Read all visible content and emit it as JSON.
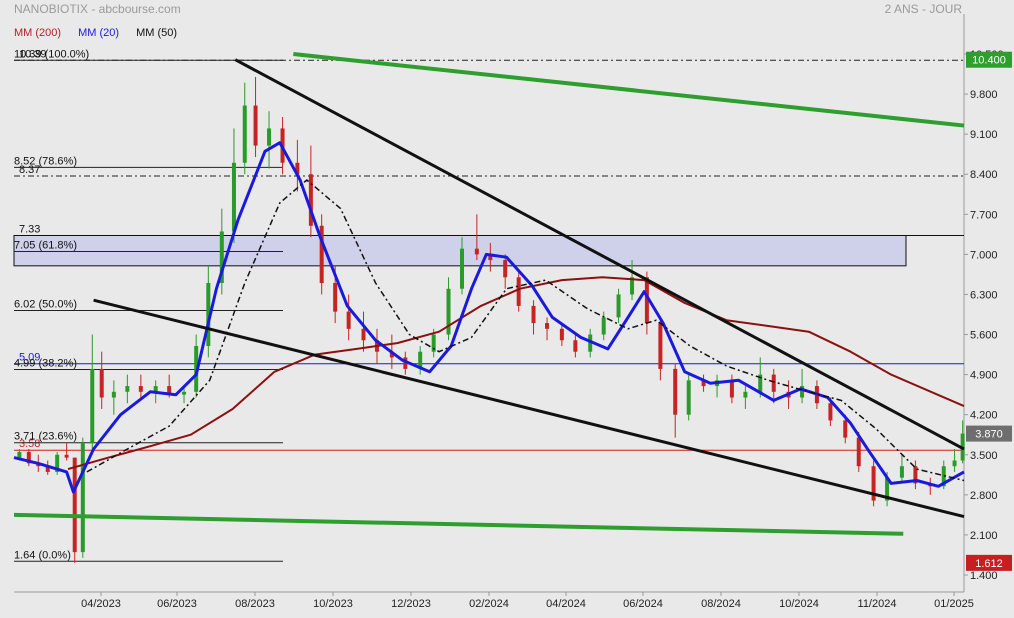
{
  "header": {
    "title": "NANOBIOTIX - abcbourse.com",
    "period": "2 ANS - JOUR"
  },
  "legend": [
    {
      "label": "MM (200)",
      "color": "#b22222"
    },
    {
      "label": "MM (20)",
      "color": "#1a1adb"
    },
    {
      "label": "MM (50)",
      "color": "#111111"
    }
  ],
  "chart_data": {
    "type": "line",
    "title": "NANOBIOTIX",
    "ylim": [
      1.4,
      10.5
    ],
    "y_ticks": [
      {
        "label": "10.500",
        "v": 10.5
      },
      {
        "label": "9.800",
        "v": 9.8
      },
      {
        "label": "9.100",
        "v": 9.1
      },
      {
        "label": "8.400",
        "v": 8.4
      },
      {
        "label": "7.700",
        "v": 7.7
      },
      {
        "label": "7.000",
        "v": 7.0
      },
      {
        "label": "6.300",
        "v": 6.3
      },
      {
        "label": "5.600",
        "v": 5.6
      },
      {
        "label": "4.900",
        "v": 4.9
      },
      {
        "label": "4.200",
        "v": 4.2
      },
      {
        "label": "3.500",
        "v": 3.5
      },
      {
        "label": "2.800",
        "v": 2.8
      },
      {
        "label": "2.100",
        "v": 2.1
      },
      {
        "label": "1.400",
        "v": 1.4
      }
    ],
    "x_labels": [
      "04/2023",
      "06/2023",
      "08/2023",
      "10/2023",
      "12/2023",
      "02/2024",
      "04/2024",
      "06/2024",
      "08/2024",
      "10/2024",
      "11/2024",
      "01/2025"
    ],
    "x_range": [
      "2023-02-20",
      "2025-01-24"
    ],
    "price_badges": [
      {
        "label": "10.400",
        "v": 10.4,
        "color": "#2e9e2e"
      },
      {
        "label": "3.870",
        "v": 3.87,
        "color": "#6e6e6e"
      },
      {
        "label": "1.612",
        "v": 1.612,
        "color": "#c61f1f"
      }
    ],
    "fibonacci": [
      {
        "label": "10.39 (100.0%)",
        "v": 10.39
      },
      {
        "label": "8.52  (78.6%)",
        "v": 8.52
      },
      {
        "label": "7.05  (61.8%)",
        "v": 7.05
      },
      {
        "label": "6.02  (50.0%)",
        "v": 6.02
      },
      {
        "label": "4.99  (38.2%)",
        "v": 4.99
      },
      {
        "label": "3.71  (23.6%)",
        "v": 3.71
      },
      {
        "label": "1.64  (0.0%)",
        "v": 1.64
      }
    ],
    "levels": [
      {
        "label": "10.39",
        "v": 10.39,
        "style": "dashdot",
        "color": "#222222"
      },
      {
        "label": "8.37",
        "v": 8.37,
        "style": "dashdot",
        "color": "#222222"
      },
      {
        "label": "7.33",
        "v": 7.33,
        "style": "solid",
        "color": "#111111"
      },
      {
        "label": "5.09",
        "v": 5.09,
        "style": "solid",
        "color": "#1a1acc"
      },
      {
        "label": "3.58",
        "v": 3.58,
        "style": "solid",
        "color": "#d02020"
      }
    ],
    "zone": {
      "from": 6.8,
      "to": 7.33,
      "color": "#cfd0ea"
    },
    "trendlines": [
      {
        "name": "",
        "color": "#2e9e2e",
        "width": 4,
        "points": [
          [
            "2023-09-15",
            10.5
          ],
          [
            "2025-01-24",
            9.25
          ]
        ]
      },
      {
        "name": "",
        "color": "#2e9e2e",
        "width": 4,
        "points": [
          [
            "2023-02-20",
            2.45
          ],
          [
            "2024-12-10",
            2.12
          ]
        ]
      },
      {
        "name": "",
        "color": "#111111",
        "width": 3,
        "points": [
          [
            "2023-08-03",
            10.4
          ],
          [
            "2025-01-24",
            3.6
          ]
        ]
      },
      {
        "name": "",
        "color": "#111111",
        "width": 3,
        "points": [
          [
            "2023-04-20",
            6.2
          ],
          [
            "2025-01-24",
            2.42
          ]
        ]
      }
    ],
    "series": [
      {
        "name": "MM (200)",
        "color": "#8b1010",
        "width": 2,
        "points": [
          [
            "2023-04-01",
            3.25
          ],
          [
            "2023-05-01",
            3.45
          ],
          [
            "2023-06-01",
            3.65
          ],
          [
            "2023-07-01",
            3.85
          ],
          [
            "2023-08-01",
            4.3
          ],
          [
            "2023-09-01",
            4.95
          ],
          [
            "2023-10-01",
            5.25
          ],
          [
            "2023-11-01",
            5.35
          ],
          [
            "2023-12-01",
            5.45
          ],
          [
            "2024-01-01",
            5.65
          ],
          [
            "2024-02-01",
            6.1
          ],
          [
            "2024-03-01",
            6.4
          ],
          [
            "2024-04-01",
            6.55
          ],
          [
            "2024-05-01",
            6.6
          ],
          [
            "2024-06-01",
            6.55
          ],
          [
            "2024-07-01",
            6.15
          ],
          [
            "2024-08-01",
            5.85
          ],
          [
            "2024-09-01",
            5.75
          ],
          [
            "2024-10-01",
            5.65
          ],
          [
            "2024-11-01",
            5.3
          ],
          [
            "2024-12-01",
            4.9
          ],
          [
            "2025-01-24",
            4.35
          ]
        ]
      },
      {
        "name": "MM (20)",
        "color": "#1a1adb",
        "width": 3,
        "points": [
          [
            "2023-02-20",
            3.45
          ],
          [
            "2023-03-10",
            3.35
          ],
          [
            "2023-03-31",
            3.2
          ],
          [
            "2023-04-05",
            2.85
          ],
          [
            "2023-04-20",
            3.6
          ],
          [
            "2023-05-10",
            4.2
          ],
          [
            "2023-06-01",
            4.6
          ],
          [
            "2023-06-20",
            4.55
          ],
          [
            "2023-07-05",
            4.9
          ],
          [
            "2023-07-20",
            6.4
          ],
          [
            "2023-08-05",
            7.6
          ],
          [
            "2023-08-25",
            8.8
          ],
          [
            "2023-09-05",
            8.95
          ],
          [
            "2023-09-20",
            8.3
          ],
          [
            "2023-10-05",
            7.3
          ],
          [
            "2023-10-25",
            6.1
          ],
          [
            "2023-11-15",
            5.5
          ],
          [
            "2023-12-05",
            5.15
          ],
          [
            "2023-12-25",
            4.95
          ],
          [
            "2024-01-10",
            5.4
          ],
          [
            "2024-01-25",
            6.4
          ],
          [
            "2024-02-05",
            7.0
          ],
          [
            "2024-02-20",
            6.95
          ],
          [
            "2024-03-10",
            6.45
          ],
          [
            "2024-03-25",
            5.9
          ],
          [
            "2024-04-15",
            5.55
          ],
          [
            "2024-05-05",
            5.35
          ],
          [
            "2024-05-20",
            5.9
          ],
          [
            "2024-06-01",
            6.35
          ],
          [
            "2024-06-15",
            5.8
          ],
          [
            "2024-07-01",
            4.95
          ],
          [
            "2024-07-20",
            4.75
          ],
          [
            "2024-08-10",
            4.8
          ],
          [
            "2024-09-05",
            4.45
          ],
          [
            "2024-09-25",
            4.65
          ],
          [
            "2024-10-15",
            4.5
          ],
          [
            "2024-11-01",
            4.05
          ],
          [
            "2024-11-15",
            3.55
          ],
          [
            "2024-12-01",
            3.0
          ],
          [
            "2024-12-20",
            3.05
          ],
          [
            "2025-01-05",
            2.95
          ],
          [
            "2025-01-24",
            3.2
          ]
        ]
      },
      {
        "name": "MM (50)",
        "color": "#111111",
        "width": 1.5,
        "dash": "6,3,2,3",
        "points": [
          [
            "2023-04-15",
            3.2
          ],
          [
            "2023-05-15",
            3.6
          ],
          [
            "2023-06-15",
            4.0
          ],
          [
            "2023-07-15",
            4.8
          ],
          [
            "2023-08-10",
            6.5
          ],
          [
            "2023-09-05",
            7.9
          ],
          [
            "2023-09-25",
            8.3
          ],
          [
            "2023-10-20",
            7.8
          ],
          [
            "2023-11-15",
            6.5
          ],
          [
            "2023-12-10",
            5.6
          ],
          [
            "2024-01-01",
            5.3
          ],
          [
            "2024-01-25",
            5.55
          ],
          [
            "2024-02-20",
            6.4
          ],
          [
            "2024-03-20",
            6.55
          ],
          [
            "2024-04-20",
            6.05
          ],
          [
            "2024-05-20",
            5.7
          ],
          [
            "2024-06-10",
            5.85
          ],
          [
            "2024-07-05",
            5.4
          ],
          [
            "2024-08-01",
            5.05
          ],
          [
            "2024-09-01",
            4.8
          ],
          [
            "2024-10-01",
            4.6
          ],
          [
            "2024-10-25",
            4.45
          ],
          [
            "2024-11-20",
            3.95
          ],
          [
            "2024-12-20",
            3.25
          ],
          [
            "2025-01-24",
            3.05
          ]
        ]
      }
    ],
    "candles": [
      [
        "2023-02-24",
        3.45,
        3.6,
        3.4,
        3.55
      ],
      [
        "2023-03-03",
        3.55,
        3.6,
        3.3,
        3.35
      ],
      [
        "2023-03-10",
        3.35,
        3.5,
        3.2,
        3.3
      ],
      [
        "2023-03-17",
        3.3,
        3.4,
        3.15,
        3.2
      ],
      [
        "2023-03-24",
        3.2,
        3.55,
        3.15,
        3.5
      ],
      [
        "2023-03-31",
        3.5,
        3.7,
        3.4,
        3.45
      ],
      [
        "2023-04-06",
        3.45,
        3.45,
        1.612,
        1.8
      ],
      [
        "2023-04-12",
        1.8,
        3.8,
        1.7,
        3.7
      ],
      [
        "2023-04-19",
        3.7,
        5.6,
        3.6,
        5.0
      ],
      [
        "2023-04-26",
        5.0,
        5.3,
        4.3,
        4.5
      ],
      [
        "2023-05-05",
        4.5,
        4.8,
        4.2,
        4.6
      ],
      [
        "2023-05-15",
        4.6,
        4.9,
        4.4,
        4.7
      ],
      [
        "2023-05-25",
        4.7,
        4.9,
        4.5,
        4.6
      ],
      [
        "2023-06-05",
        4.6,
        4.8,
        4.4,
        4.7
      ],
      [
        "2023-06-15",
        4.7,
        4.9,
        4.5,
        4.55
      ],
      [
        "2023-06-26",
        4.55,
        4.7,
        4.4,
        4.6
      ],
      [
        "2023-07-05",
        4.6,
        5.6,
        4.5,
        5.4
      ],
      [
        "2023-07-14",
        5.4,
        6.8,
        5.2,
        6.5
      ],
      [
        "2023-07-24",
        6.5,
        7.8,
        6.3,
        7.4
      ],
      [
        "2023-08-02",
        7.4,
        9.2,
        7.2,
        8.6
      ],
      [
        "2023-08-10",
        8.6,
        10.0,
        8.4,
        9.6
      ],
      [
        "2023-08-18",
        9.6,
        10.1,
        8.7,
        8.9
      ],
      [
        "2023-08-28",
        8.9,
        9.5,
        8.5,
        9.2
      ],
      [
        "2023-09-07",
        9.2,
        9.4,
        8.4,
        8.6
      ],
      [
        "2023-09-18",
        8.6,
        9.0,
        8.1,
        8.4
      ],
      [
        "2023-09-28",
        8.4,
        8.9,
        7.3,
        7.5
      ],
      [
        "2023-10-06",
        7.5,
        7.7,
        6.3,
        6.5
      ],
      [
        "2023-10-16",
        6.5,
        6.8,
        5.8,
        6.0
      ],
      [
        "2023-10-26",
        6.0,
        6.3,
        5.5,
        5.7
      ],
      [
        "2023-11-06",
        5.7,
        6.0,
        5.3,
        5.5
      ],
      [
        "2023-11-16",
        5.5,
        5.7,
        5.1,
        5.3
      ],
      [
        "2023-11-27",
        5.3,
        5.6,
        5.0,
        5.2
      ],
      [
        "2023-12-07",
        5.2,
        5.3,
        4.9,
        5.0
      ],
      [
        "2023-12-18",
        5.0,
        5.4,
        4.9,
        5.3
      ],
      [
        "2023-12-28",
        5.3,
        5.7,
        5.2,
        5.6
      ],
      [
        "2024-01-08",
        5.6,
        6.6,
        5.5,
        6.4
      ],
      [
        "2024-01-18",
        6.4,
        7.3,
        6.3,
        7.1
      ],
      [
        "2024-01-29",
        7.1,
        7.7,
        6.9,
        7.0
      ],
      [
        "2024-02-08",
        7.0,
        7.2,
        6.7,
        6.9
      ],
      [
        "2024-02-19",
        6.9,
        7.0,
        6.4,
        6.6
      ],
      [
        "2024-02-29",
        6.6,
        6.7,
        6.0,
        6.1
      ],
      [
        "2024-03-11",
        6.1,
        6.2,
        5.6,
        5.8
      ],
      [
        "2024-03-21",
        5.8,
        5.9,
        5.5,
        5.7
      ],
      [
        "2024-04-01",
        5.7,
        5.8,
        5.4,
        5.5
      ],
      [
        "2024-04-11",
        5.5,
        5.6,
        5.2,
        5.3
      ],
      [
        "2024-04-22",
        5.3,
        5.7,
        5.2,
        5.6
      ],
      [
        "2024-05-02",
        5.6,
        6.0,
        5.5,
        5.9
      ],
      [
        "2024-05-13",
        5.9,
        6.4,
        5.8,
        6.3
      ],
      [
        "2024-05-23",
        6.3,
        6.9,
        6.2,
        6.6
      ],
      [
        "2024-06-03",
        6.6,
        6.7,
        5.6,
        5.8
      ],
      [
        "2024-06-13",
        5.8,
        5.9,
        4.8,
        5.0
      ],
      [
        "2024-06-24",
        5.0,
        5.1,
        3.8,
        4.2
      ],
      [
        "2024-07-04",
        4.2,
        4.9,
        4.1,
        4.8
      ],
      [
        "2024-07-15",
        4.8,
        4.9,
        4.6,
        4.7
      ],
      [
        "2024-07-25",
        4.7,
        4.9,
        4.5,
        4.8
      ],
      [
        "2024-08-05",
        4.8,
        4.9,
        4.4,
        4.5
      ],
      [
        "2024-08-15",
        4.5,
        4.7,
        4.3,
        4.6
      ],
      [
        "2024-08-26",
        4.6,
        5.2,
        4.5,
        4.9
      ],
      [
        "2024-09-05",
        4.9,
        5.0,
        4.4,
        4.6
      ],
      [
        "2024-09-16",
        4.6,
        4.8,
        4.3,
        4.5
      ],
      [
        "2024-09-26",
        4.5,
        5.0,
        4.4,
        4.7
      ],
      [
        "2024-10-07",
        4.7,
        4.8,
        4.3,
        4.4
      ],
      [
        "2024-10-17",
        4.4,
        4.5,
        4.0,
        4.1
      ],
      [
        "2024-10-28",
        4.1,
        4.2,
        3.7,
        3.8
      ],
      [
        "2024-11-07",
        3.8,
        3.9,
        3.2,
        3.3
      ],
      [
        "2024-11-18",
        3.3,
        3.4,
        2.6,
        2.7
      ],
      [
        "2024-11-28",
        2.7,
        3.2,
        2.6,
        3.1
      ],
      [
        "2024-12-09",
        3.1,
        3.5,
        3.0,
        3.3
      ],
      [
        "2024-12-19",
        3.3,
        3.4,
        2.9,
        3.0
      ],
      [
        "2024-12-30",
        3.0,
        3.1,
        2.8,
        2.95
      ],
      [
        "2025-01-09",
        2.95,
        3.4,
        2.9,
        3.3
      ],
      [
        "2025-01-17",
        3.3,
        3.6,
        3.2,
        3.4
      ],
      [
        "2025-01-23",
        3.4,
        4.1,
        3.35,
        3.87
      ]
    ]
  }
}
